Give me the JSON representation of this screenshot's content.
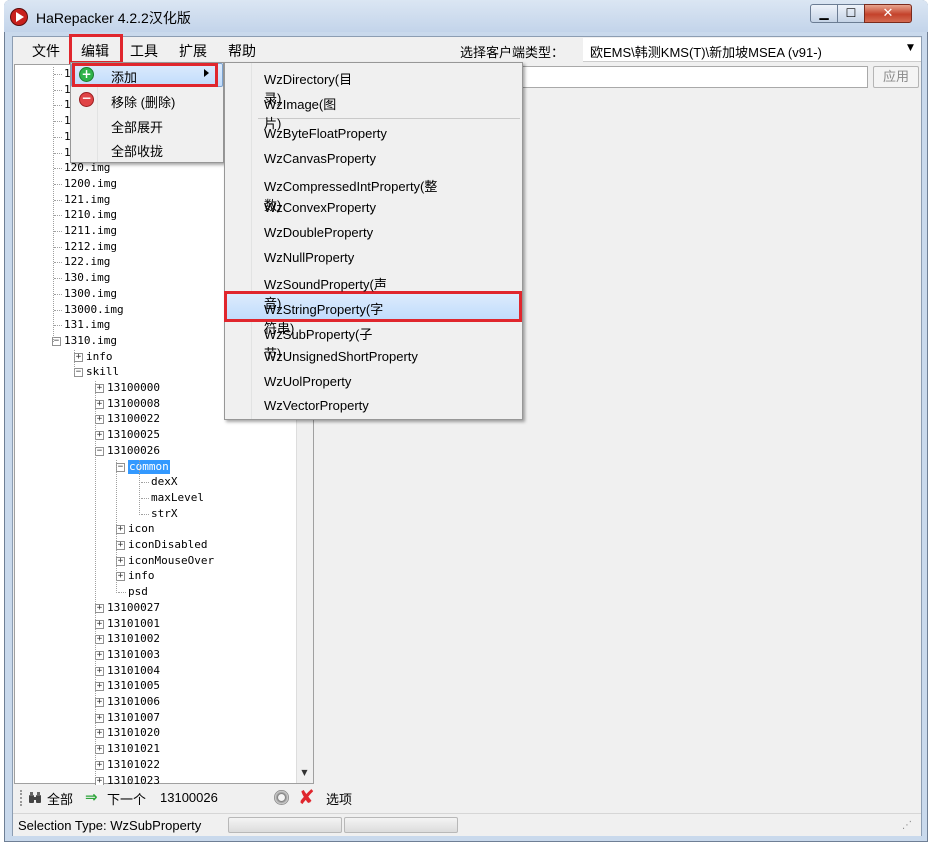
{
  "window": {
    "title": "HaRepacker 4.2.2汉化版"
  },
  "menubar": {
    "file": "文件",
    "edit": "编辑",
    "tools": "工具",
    "extend": "扩展",
    "help": "帮助",
    "client_type_label": "选择客户端类型：",
    "client_type_value": "欧EMS\\韩测KMS(T)\\新加坡MSEA (v91-)"
  },
  "apply_button": "应用",
  "edit_menu": {
    "add": "添加",
    "remove": "移除 (删除)",
    "expand_all": "全部展开",
    "collapse_all": "全部收拢"
  },
  "add_submenu": {
    "items": [
      "WzDirectory(目录)",
      "WzImage(图片)",
      "WzByteFloatProperty",
      "WzCanvasProperty",
      "WzCompressedIntProperty(整数)",
      "WzConvexProperty",
      "WzDoubleProperty",
      "WzNullProperty",
      "WzSoundProperty(声音)",
      "WzStringProperty(字符串)",
      "WzSubProperty(子节)",
      "WzUnsignedShortProperty",
      "WzUolProperty",
      "WzVectorProperty"
    ],
    "highlighted": "WzStringProperty(字符串)"
  },
  "tree": {
    "hidden_prefix": [
      "1",
      "1",
      "1",
      "1",
      "1",
      "1"
    ],
    "img_nodes": [
      "120.img",
      "1200.img",
      "121.img",
      "1210.img",
      "1211.img",
      "1212.img",
      "122.img",
      "130.img",
      "1300.img",
      "13000.img",
      "131.img",
      "1310.img"
    ],
    "img_children": [
      "info",
      "skill"
    ],
    "skill_children_top": [
      "13100000",
      "13100008",
      "13100022",
      "13100025",
      "13100026"
    ],
    "skill26_children": [
      "common"
    ],
    "common_children": [
      "dexX",
      "maxLevel",
      "strX"
    ],
    "skill26_more": [
      "icon",
      "iconDisabled",
      "iconMouseOver",
      "info",
      "psd"
    ],
    "skill_children_bottom": [
      "13100027",
      "13101001",
      "13101002",
      "13101003",
      "13101004",
      "13101005",
      "13101006",
      "13101007",
      "13101020",
      "13101021",
      "13101022",
      "13101023"
    ]
  },
  "searchbar": {
    "find_all": "全部",
    "next": "下一个",
    "search_value": "13100026",
    "options": "选项"
  },
  "status": {
    "text": "Selection Type: WzSubProperty"
  }
}
